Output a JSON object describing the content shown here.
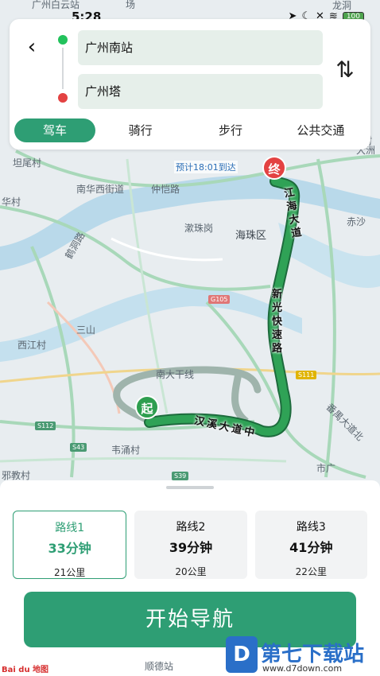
{
  "status_bar": {
    "time": "5:28",
    "battery": "100"
  },
  "search": {
    "from": "广州南站",
    "to": "广州塔"
  },
  "modes": [
    "驾车",
    "骑行",
    "步行",
    "公共交通"
  ],
  "map": {
    "eta": "预计18:01到达",
    "end_marker": "终",
    "start_marker": "起",
    "labels": [
      "广州白云站",
      "坦尾村",
      "南华西街道",
      "仲恺路",
      "华村",
      "鹤洞路",
      "漱珠岗",
      "海珠区",
      "赤沙",
      "三山",
      "西江村",
      "南大干线",
      "韦涌村",
      "邪教村",
      "番禺大道北",
      "市广",
      "顺德站",
      "龙洞",
      "德村",
      "大洲",
      "场"
    ],
    "shields": [
      "G105",
      "S111",
      "S112",
      "S43",
      "S39"
    ],
    "route_road_1": "江海大道",
    "route_road_2": "新光快速路",
    "route_road_3": "汉溪大道中"
  },
  "routes": [
    {
      "name": "路线1",
      "time": "33分钟",
      "distance": "21公里"
    },
    {
      "name": "路线2",
      "time": "39分钟",
      "distance": "20公里"
    },
    {
      "name": "路线3",
      "time": "41分钟",
      "distance": "22公里"
    }
  ],
  "start_button": "开始导航",
  "baidu_logo": "Bai du 地图",
  "watermark": {
    "icon": "D",
    "title": "第七下载站",
    "url": "www.d7down.com"
  },
  "colors": {
    "accent": "#2e9e74",
    "start": "#22c25c",
    "end": "#e34242"
  }
}
